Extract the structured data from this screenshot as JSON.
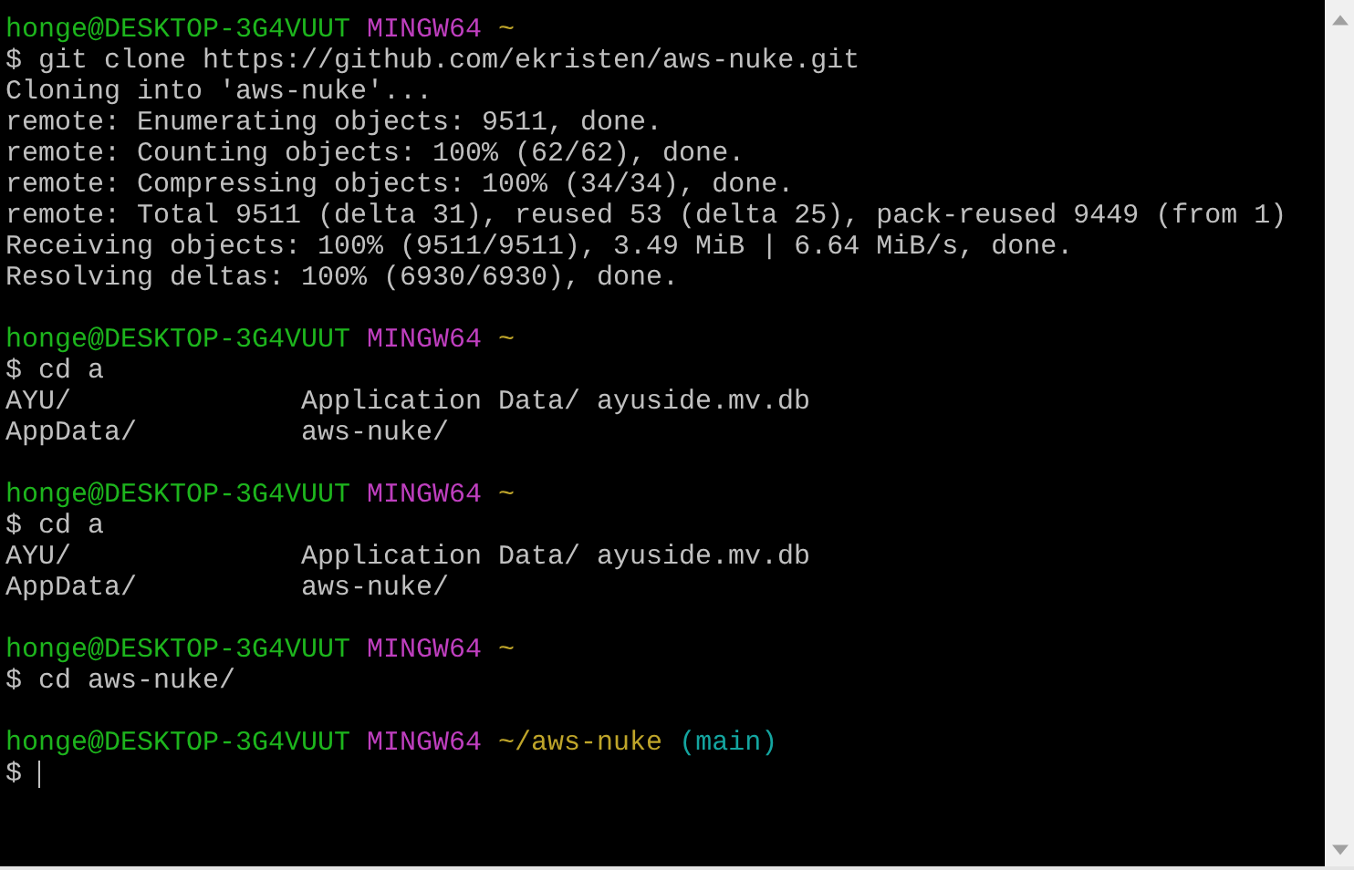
{
  "terminal": {
    "blocks": [
      {
        "prompt": {
          "user_host": "honge@DESKTOP-3G4VUUT",
          "system": "MINGW64",
          "path": "~"
        },
        "command": "$ git clone https://github.com/ekristen/aws-nuke.git",
        "output": [
          {
            "kind": "text",
            "text": "Cloning into 'aws-nuke'..."
          },
          {
            "kind": "text",
            "text": "remote: Enumerating objects: 9511, done."
          },
          {
            "kind": "text",
            "text": "remote: Counting objects: 100% (62/62), done."
          },
          {
            "kind": "text",
            "text": "remote: Compressing objects: 100% (34/34), done."
          },
          {
            "kind": "text",
            "text": "remote: Total 9511 (delta 31), reused 53 (delta 25), pack-reused 9449 (from 1)"
          },
          {
            "kind": "text",
            "text": "Receiving objects: 100% (9511/9511), 3.49 MiB | 6.64 MiB/s, done."
          },
          {
            "kind": "text",
            "text": "Resolving deltas: 100% (6930/6930), done."
          }
        ]
      },
      {
        "prompt": {
          "user_host": "honge@DESKTOP-3G4VUUT",
          "system": "MINGW64",
          "path": "~"
        },
        "command": "$ cd a",
        "output": [
          {
            "kind": "listing",
            "entries": [
              "AYU/",
              "Application Data/",
              "ayuside.mv.db",
              "AppData/",
              "aws-nuke/"
            ]
          }
        ]
      },
      {
        "prompt": {
          "user_host": "honge@DESKTOP-3G4VUUT",
          "system": "MINGW64",
          "path": "~"
        },
        "command": "$ cd a",
        "output": [
          {
            "kind": "listing",
            "entries": [
              "AYU/",
              "Application Data/",
              "ayuside.mv.db",
              "AppData/",
              "aws-nuke/"
            ]
          }
        ]
      },
      {
        "prompt": {
          "user_host": "honge@DESKTOP-3G4VUUT",
          "system": "MINGW64",
          "path": "~"
        },
        "command": "$ cd aws-nuke/"
      },
      {
        "prompt": {
          "user_host": "honge@DESKTOP-3G4VUUT",
          "system": "MINGW64",
          "path": "~/aws-nuke",
          "branch": "(main)"
        },
        "input": {
          "prompt_sign": "$",
          "cursor": true
        }
      }
    ]
  }
}
